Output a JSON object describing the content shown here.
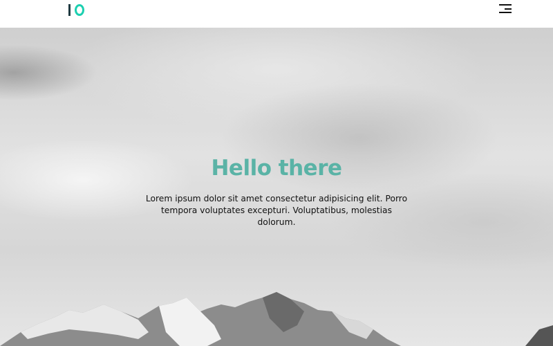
{
  "header": {
    "logo": "IO",
    "menu_icon": "hamburger-icon"
  },
  "colors": {
    "accent": "#5ab3a6",
    "logo_teal": "#1ccfb0"
  },
  "hero": {
    "title": "Hello there",
    "text": "Lorem ipsum dolor sit amet consectetur adipisicing elit. Porro tempora voluptates excepturi. Voluptatibus, molestias dolorum."
  }
}
